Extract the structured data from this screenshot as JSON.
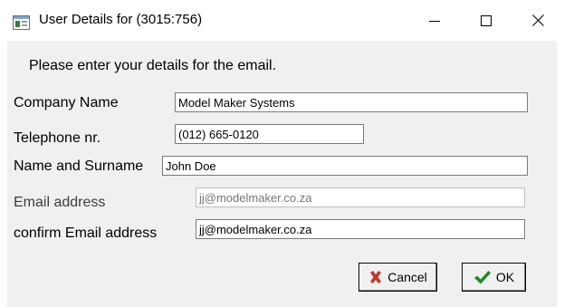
{
  "window": {
    "title": "User Details for (3015:756)",
    "controls": {
      "minimize": "minimize",
      "maximize": "maximize",
      "close": "close"
    }
  },
  "form": {
    "instruction": "Please enter your details for the email.",
    "fields": {
      "company": {
        "label": "Company Name",
        "value": "Model Maker Systems"
      },
      "telephone": {
        "label": "Telephone nr.",
        "value": "(012) 665-0120"
      },
      "name": {
        "label": "Name and Surname",
        "value": "John Doe"
      },
      "email": {
        "label": "Email address",
        "placeholder": "jj@modelmaker.co.za"
      },
      "confirm_email": {
        "label": "confirm Email address",
        "value": "jj@modelmaker.co.za"
      }
    }
  },
  "buttons": {
    "cancel": {
      "label": "Cancel",
      "icon": "x-icon",
      "icon_color": "#c0392b"
    },
    "ok": {
      "label": "OK",
      "icon": "check-icon",
      "icon_color": "#1e8a1e"
    }
  },
  "colors": {
    "client_bg": "#f0f0f0",
    "title_bg": "#ffffff"
  }
}
